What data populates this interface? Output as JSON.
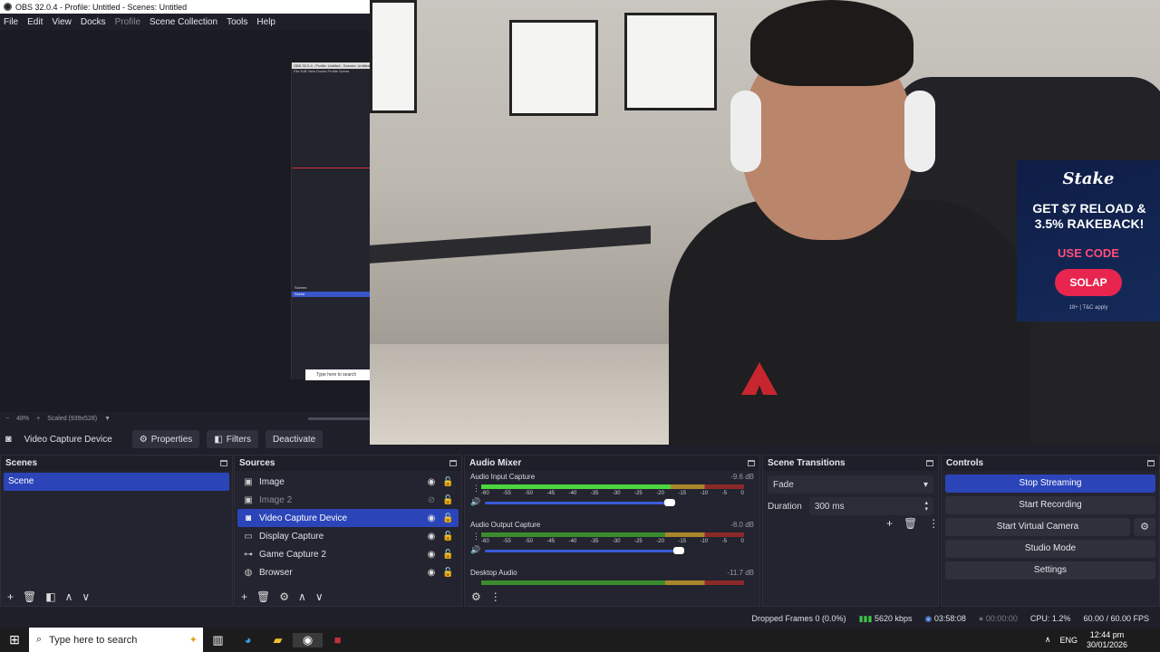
{
  "window": {
    "title": "OBS 32.0.4 - Profile: Untitled - Scenes: Untitled"
  },
  "menu": [
    "File",
    "Edit",
    "View",
    "Docks",
    "Profile",
    "Scene Collection",
    "Tools",
    "Help"
  ],
  "nested_preview": {
    "title": "OBS 32.0.4 - Profile: Untitled - Scenes: Untitled",
    "menu": "File  Edit  View  Docks  Profile  Scene",
    "source_label": "Video Capture Device",
    "scenes_label": "Scenes",
    "scene_item": "Scene",
    "search_placeholder": "Type here to search"
  },
  "preview_bar": {
    "zoom": "48%",
    "scaled": "Scaled (939x528)"
  },
  "ad": {
    "brand": "Stake",
    "line1": "GET $7 RELOAD &",
    "line2": "3.5% RAKEBACK!",
    "code_label": "USE CODE",
    "code": "SOLAP",
    "terms": "18+ | T&C apply"
  },
  "source_toolbar": {
    "source_name": "Video Capture Device",
    "properties": "Properties",
    "filters": "Filters",
    "deactivate": "Deactivate"
  },
  "scenes": {
    "title": "Scenes",
    "items": [
      "Scene"
    ]
  },
  "sources": {
    "title": "Sources",
    "items": [
      {
        "name": "Image",
        "icon": "image-icon",
        "visible": true
      },
      {
        "name": "Image 2",
        "icon": "image-icon",
        "visible": false
      },
      {
        "name": "Video Capture Device",
        "icon": "camera-icon",
        "visible": true,
        "selected": true
      },
      {
        "name": "Display Capture",
        "icon": "monitor-icon",
        "visible": true
      },
      {
        "name": "Game Capture 2",
        "icon": "gamepad-icon",
        "visible": true
      },
      {
        "name": "Browser",
        "icon": "globe-icon",
        "visible": true
      }
    ]
  },
  "audio_mixer": {
    "title": "Audio Mixer",
    "scale": [
      "-60",
      "-55",
      "-50",
      "-45",
      "-40",
      "-35",
      "-30",
      "-25",
      "-20",
      "-15",
      "-10",
      "-5",
      "0"
    ],
    "channels": [
      {
        "name": "Audio Input Capture",
        "db": "-9.6 dB",
        "level": 0.72
      },
      {
        "name": "Audio Output Capture",
        "db": "-8.0 dB",
        "level": 0.0
      },
      {
        "name": "Desktop Audio",
        "db": "-11.7 dB",
        "level": 0.0
      }
    ]
  },
  "scene_transitions": {
    "title": "Scene Transitions",
    "transition": "Fade",
    "duration_label": "Duration",
    "duration": "300 ms"
  },
  "controls": {
    "title": "Controls",
    "stop_streaming": "Stop Streaming",
    "start_recording": "Start Recording",
    "start_virtual_camera": "Start Virtual Camera",
    "studio_mode": "Studio Mode",
    "settings": "Settings"
  },
  "status": {
    "dropped_frames": "Dropped Frames 0 (0.0%)",
    "bitrate": "5620 kbps",
    "stream_time": "03:58:08",
    "rec_time": "00:00:00",
    "cpu": "CPU: 1.2%",
    "fps": "60.00 / 60.00 FPS"
  },
  "taskbar": {
    "search_placeholder": "Type here to search",
    "lang": "ENG",
    "time": "12:44 pm",
    "date": "30/01/2026"
  }
}
